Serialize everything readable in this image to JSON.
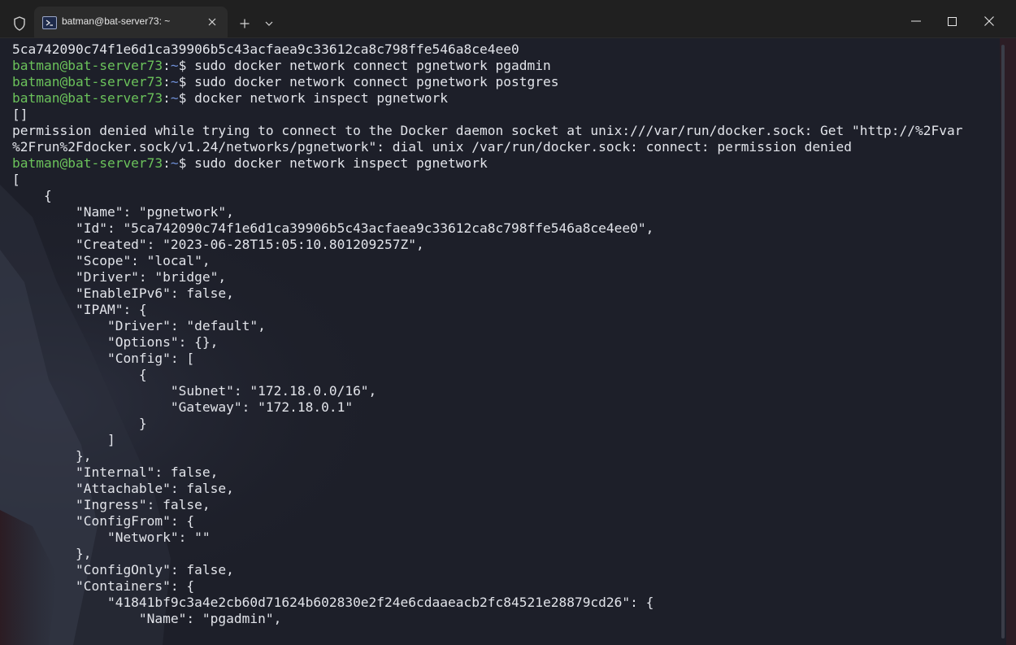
{
  "window": {
    "tab_title": "batman@bat-server73: ~",
    "new_tab_label": "+",
    "dropdown_label": "⌄",
    "close_tab_label": "✕"
  },
  "icons": {
    "shield": "shield-icon",
    "terminal": "powershell-terminal-icon",
    "minimize": "minimize-icon",
    "maximize": "maximize-icon",
    "close": "close-icon"
  },
  "colors": {
    "prompt_user": "#6bc25b",
    "prompt_path": "#6f8fd6",
    "text": "#e2e4ea",
    "background": "#1d1f29"
  },
  "prompt": {
    "user_host": "batman@bat-server73",
    "sep": ":",
    "path": "~",
    "symbol": "$ "
  },
  "terminal": {
    "lines": [
      {
        "text": "5ca742090c74f1e6d1ca39906b5c43acfaea9c33612ca8c798ffe546a8ce4ee0"
      },
      {
        "prompt": true,
        "cmd": "sudo docker network connect pgnetwork pgadmin"
      },
      {
        "prompt": true,
        "cmd": "sudo docker network connect pgnetwork postgres"
      },
      {
        "prompt": true,
        "cmd": "docker network inspect pgnetwork"
      },
      {
        "text": "[]"
      },
      {
        "text": "permission denied while trying to connect to the Docker daemon socket at unix:///var/run/docker.sock: Get \"http://%2Fvar"
      },
      {
        "text": "%2Frun%2Fdocker.sock/v1.24/networks/pgnetwork\": dial unix /var/run/docker.sock: connect: permission denied"
      },
      {
        "prompt": true,
        "cmd": "sudo docker network inspect pgnetwork"
      },
      {
        "text": "["
      },
      {
        "text": "    {"
      },
      {
        "text": "        \"Name\": \"pgnetwork\","
      },
      {
        "text": "        \"Id\": \"5ca742090c74f1e6d1ca39906b5c43acfaea9c33612ca8c798ffe546a8ce4ee0\","
      },
      {
        "text": "        \"Created\": \"2023-06-28T15:05:10.801209257Z\","
      },
      {
        "text": "        \"Scope\": \"local\","
      },
      {
        "text": "        \"Driver\": \"bridge\","
      },
      {
        "text": "        \"EnableIPv6\": false,"
      },
      {
        "text": "        \"IPAM\": {"
      },
      {
        "text": "            \"Driver\": \"default\","
      },
      {
        "text": "            \"Options\": {},"
      },
      {
        "text": "            \"Config\": ["
      },
      {
        "text": "                {"
      },
      {
        "text": "                    \"Subnet\": \"172.18.0.0/16\","
      },
      {
        "text": "                    \"Gateway\": \"172.18.0.1\""
      },
      {
        "text": "                }"
      },
      {
        "text": "            ]"
      },
      {
        "text": "        },"
      },
      {
        "text": "        \"Internal\": false,"
      },
      {
        "text": "        \"Attachable\": false,"
      },
      {
        "text": "        \"Ingress\": false,"
      },
      {
        "text": "        \"ConfigFrom\": {"
      },
      {
        "text": "            \"Network\": \"\""
      },
      {
        "text": "        },"
      },
      {
        "text": "        \"ConfigOnly\": false,"
      },
      {
        "text": "        \"Containers\": {"
      },
      {
        "text": "            \"41841bf9c3a4e2cb60d71624b602830e2f24e6cdaaeacb2fc84521e28879cd26\": {"
      },
      {
        "text": "                \"Name\": \"pgadmin\","
      }
    ]
  }
}
